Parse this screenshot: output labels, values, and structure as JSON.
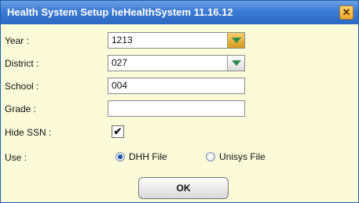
{
  "dialog": {
    "title": "Health System Setup heHealthSystem 11.16.12",
    "close_icon": "close-icon"
  },
  "form": {
    "year": {
      "label": "Year :",
      "value": "1213"
    },
    "district": {
      "label": "District :",
      "value": "027"
    },
    "school": {
      "label": "School :",
      "value": "004"
    },
    "grade": {
      "label": "Grade :",
      "value": ""
    },
    "hide_ssn": {
      "label": "Hide SSN :",
      "checked": true,
      "mark": "✔"
    },
    "use": {
      "label": "Use :",
      "options": [
        {
          "label": "DHH File",
          "selected": true
        },
        {
          "label": "Unisys File",
          "selected": false
        }
      ]
    }
  },
  "buttons": {
    "ok_label": "OK"
  },
  "colors": {
    "title_bar": "#3a7bd5",
    "dialog_background": "#fbfbd9",
    "close_button": "#f2a72b",
    "dropdown_arrow": "#2c8a4a"
  }
}
